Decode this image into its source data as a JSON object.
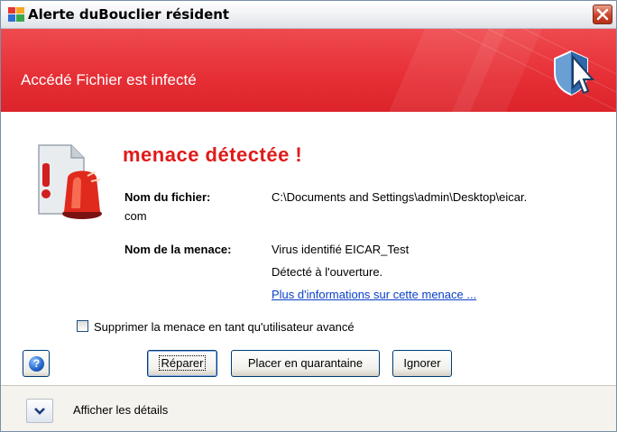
{
  "window": {
    "title": "Alerte duBouclier résident",
    "close_icon": "close-icon"
  },
  "banner": {
    "title": "Accédé Fichier est infecté",
    "icon": "shield-cursor-icon"
  },
  "threat": {
    "heading": "menace détectée !",
    "icon": "alarm-document-icon",
    "file_label": "Nom du fichier:",
    "file_value": "C:\\Documents and Settings\\admin\\Desktop\\eicar.",
    "file_value_wrap": "com",
    "threat_label": "Nom de la menace:",
    "threat_value": "Virus identifié EICAR_Test",
    "detected_note": "Détecté à l'ouverture.",
    "more_info_link": "Plus d'informations sur cette menace ..."
  },
  "options": {
    "advanced_delete_label": "Supprimer la menace en tant qu'utilisateur avancé",
    "advanced_delete_checked": false
  },
  "buttons": {
    "help_icon": "question-icon",
    "repair": "Réparer",
    "quarantine": "Placer en quarantaine",
    "ignore": "Ignorer"
  },
  "footer": {
    "expand_icon": "chevron-down-icon",
    "details_label": "Afficher les détails"
  },
  "colors": {
    "banner_red": "#e62e35",
    "heading_red": "#e01a1a",
    "link_blue": "#0a40c8"
  }
}
